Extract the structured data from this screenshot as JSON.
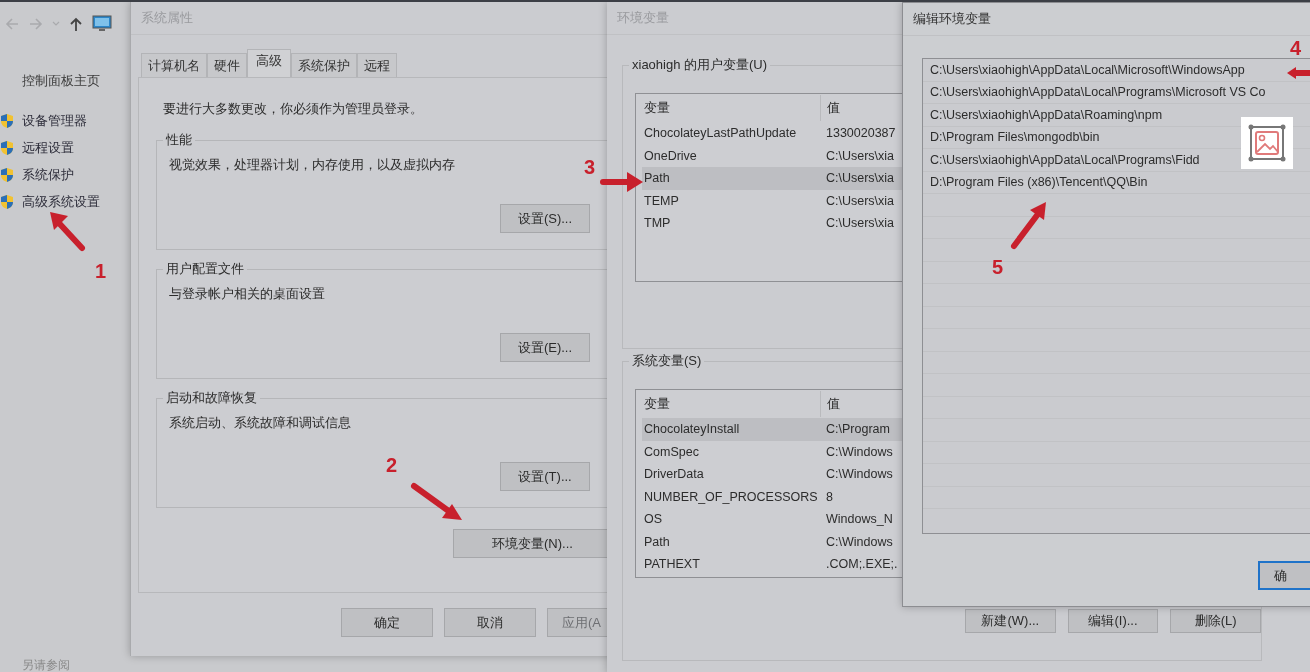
{
  "explorer": {
    "home_link": "控制面板主页",
    "links": [
      {
        "label": "设备管理器"
      },
      {
        "label": "远程设置"
      },
      {
        "label": "系统保护"
      },
      {
        "label": "高级系统设置"
      }
    ],
    "see_also": "另请参阅"
  },
  "system_properties": {
    "title": "系统属性",
    "tabs": [
      {
        "label": "计算机名",
        "selected": false
      },
      {
        "label": "硬件",
        "selected": false
      },
      {
        "label": "高级",
        "selected": true
      },
      {
        "label": "系统保护",
        "selected": false
      },
      {
        "label": "远程",
        "selected": false
      }
    ],
    "notice": "要进行大多数更改，你必须作为管理员登录。",
    "groups": [
      {
        "title": "性能",
        "description": "视觉效果，处理器计划，内存使用，以及虚拟内存",
        "button": "设置(S)..."
      },
      {
        "title": "用户配置文件",
        "description": "与登录帐户相关的桌面设置",
        "button": "设置(E)..."
      },
      {
        "title": "启动和故障恢复",
        "description": "系统启动、系统故障和调试信息",
        "button": "设置(T)..."
      }
    ],
    "env_button": "环境变量(N)...",
    "buttons": [
      {
        "label": "确定",
        "disabled": false
      },
      {
        "label": "取消",
        "disabled": false
      },
      {
        "label": "应用(A",
        "disabled": true
      }
    ]
  },
  "env_vars": {
    "title": "环境变量",
    "user_group": {
      "title": "xiaohigh 的用户变量(U)",
      "columns": [
        "变量",
        "值"
      ],
      "rows": [
        {
          "name": "ChocolateyLastPathUpdate",
          "value": "1330020387",
          "selected": false
        },
        {
          "name": "OneDrive",
          "value": "C:\\Users\\xia",
          "selected": false
        },
        {
          "name": "Path",
          "value": "C:\\Users\\xia",
          "selected": true
        },
        {
          "name": "TEMP",
          "value": "C:\\Users\\xia",
          "selected": false
        },
        {
          "name": "TMP",
          "value": "C:\\Users\\xia",
          "selected": false
        }
      ]
    },
    "system_group": {
      "title": "系统变量(S)",
      "columns": [
        "变量",
        "值"
      ],
      "rows": [
        {
          "name": "ChocolateyInstall",
          "value": "C:\\Program",
          "selected": true
        },
        {
          "name": "ComSpec",
          "value": "C:\\Windows",
          "selected": false
        },
        {
          "name": "DriverData",
          "value": "C:\\Windows",
          "selected": false
        },
        {
          "name": "NUMBER_OF_PROCESSORS",
          "value": "8",
          "selected": false
        },
        {
          "name": "OS",
          "value": "Windows_N",
          "selected": false
        },
        {
          "name": "Path",
          "value": "C:\\Windows",
          "selected": false
        },
        {
          "name": "PATHEXT",
          "value": ".COM;.EXE;.",
          "selected": false
        }
      ]
    },
    "buttons": [
      "新建(W)...",
      "编辑(I)...",
      "删除(L)"
    ]
  },
  "edit_dialog": {
    "title": "编辑环境变量",
    "entries": [
      "C:\\Users\\xiaohigh\\AppData\\Local\\Microsoft\\WindowsApp",
      "C:\\Users\\xiaohigh\\AppData\\Local\\Programs\\Microsoft VS Co",
      "C:\\Users\\xiaohigh\\AppData\\Roaming\\npm",
      "D:\\Program Files\\mongodb\\bin",
      "C:\\Users\\xiaohigh\\AppData\\Local\\Programs\\Fidd",
      "D:\\Program Files (x86)\\Tencent\\QQ\\Bin"
    ],
    "ok_button": "确"
  },
  "annotations": [
    {
      "label": "1"
    },
    {
      "label": "2"
    },
    {
      "label": "3"
    },
    {
      "label": "4"
    },
    {
      "label": "5"
    }
  ]
}
